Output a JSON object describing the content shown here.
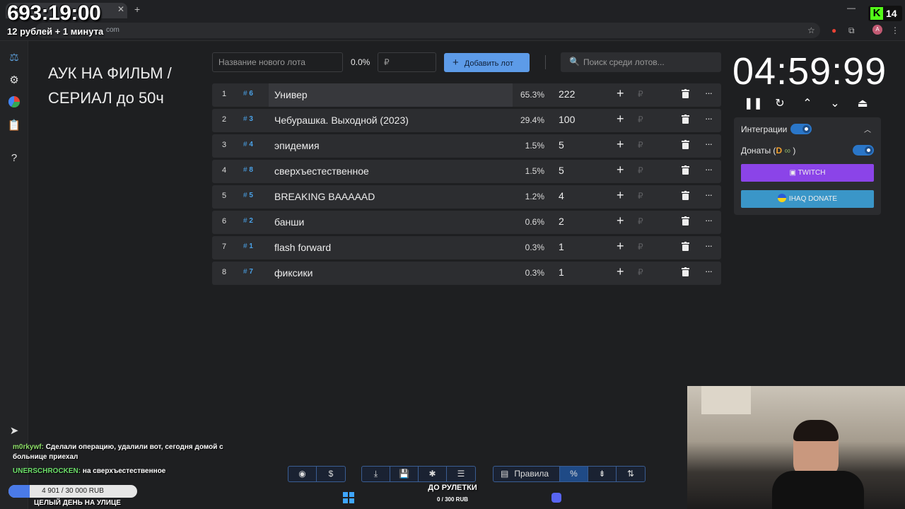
{
  "overlay": {
    "timer": "693:19:00",
    "subtitle": "12 рублей + 1 минута",
    "kick_count": "14"
  },
  "browser": {
    "url_fragment": "com"
  },
  "auction": {
    "title": "АУК НА ФИЛЬМ / СЕРИАЛ до 50ч"
  },
  "controls": {
    "new_lot_placeholder": "Название нового лота",
    "percent": "0.0%",
    "rub_placeholder": "₽",
    "add_label": "Добавить лот",
    "search_placeholder": "Поиск среди лотов..."
  },
  "lots": [
    {
      "num": "1",
      "id": "6",
      "name": "Универ",
      "pct": "65.3%",
      "amount": "222"
    },
    {
      "num": "2",
      "id": "3",
      "name": "Чебурашка. Выходной (2023)",
      "pct": "29.4%",
      "amount": "100"
    },
    {
      "num": "3",
      "id": "4",
      "name": "эпидемия",
      "pct": "1.5%",
      "amount": "5"
    },
    {
      "num": "4",
      "id": "8",
      "name": "сверхъестественное",
      "pct": "1.5%",
      "amount": "5"
    },
    {
      "num": "5",
      "id": "5",
      "name": "BREAKING BAAAAAD",
      "pct": "1.2%",
      "amount": "4"
    },
    {
      "num": "6",
      "id": "2",
      "name": "банши",
      "pct": "0.6%",
      "amount": "2"
    },
    {
      "num": "7",
      "id": "1",
      "name": "flash forward",
      "pct": "0.3%",
      "amount": "1"
    },
    {
      "num": "8",
      "id": "7",
      "name": "фиксики",
      "pct": "0.3%",
      "amount": "1"
    }
  ],
  "lot_symbols": {
    "hash": "#",
    "plus": "+",
    "ruble": "₽",
    "more": "···"
  },
  "timer": {
    "value": "04:59:99"
  },
  "integrations": {
    "label": "Интеграции",
    "donations_label": "Донаты (",
    "donations_close": ")",
    "twitch_label": "TWITCH",
    "donate_label": "IHAQ DONATE"
  },
  "toolbar": {
    "rules_label": "Правила",
    "percent_symbol": "%"
  },
  "chat": [
    {
      "user": "m0rkywf:",
      "text": "Сделали операцию, удалили вот, сегодня домой с больнице приехал"
    },
    {
      "user": "UNERSCHROCKEN:",
      "text": "на сверхъестественное"
    }
  ],
  "goal": {
    "text": "4 901 / 30 000 RUB",
    "progress": 0.163,
    "title": "ЦЕЛЫЙ ДЕНЬ НА УЛИЦЕ"
  },
  "roulette": {
    "title": "ДО РУЛЕТКИ",
    "sub": "0 / 300 RUB"
  },
  "icons": {
    "avatar_letter": "A"
  },
  "colors": {
    "accent": "#5d9be8",
    "twitch": "#8b44e8",
    "donate": "#3a96c8",
    "id_blue": "#4aa2e8"
  }
}
